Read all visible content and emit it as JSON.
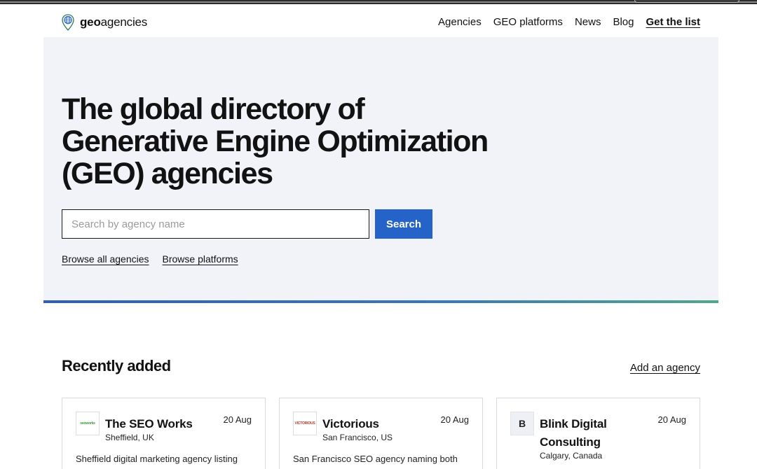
{
  "brand": {
    "name_bold": "geo",
    "name_rest": "agencies",
    "accent": "#2563c9",
    "hero_bg": "#f1f3f8",
    "icon": "globe-pin-icon"
  },
  "nav": {
    "items": [
      {
        "label": "Agencies"
      },
      {
        "label": "GEO platforms"
      },
      {
        "label": "News"
      },
      {
        "label": "Blog"
      }
    ],
    "cta_label": "Get the list"
  },
  "hero": {
    "title": "The global directory of Generative Engine Optimization (GEO) agencies",
    "search": {
      "placeholder": "Search by agency name",
      "value": "",
      "button_label": "Search"
    },
    "links": [
      {
        "label": "Browse all agencies"
      },
      {
        "label": "Browse platforms"
      }
    ]
  },
  "recent": {
    "title": "Recently added",
    "add_label": "Add an agency",
    "cards": [
      {
        "name": "The SEO Works",
        "location": "Sheffield, UK",
        "date": "20 Aug",
        "description": "Sheffield digital marketing agency listing"
      },
      {
        "name": "Victorious",
        "location": "San Francisco, US",
        "date": "20 Aug",
        "description": "San Francisco SEO agency naming both"
      },
      {
        "name": "Blink Digital Consulting",
        "location": "Calgary, Canada",
        "date": "20 Aug",
        "thumb_letter": "B"
      }
    ]
  }
}
